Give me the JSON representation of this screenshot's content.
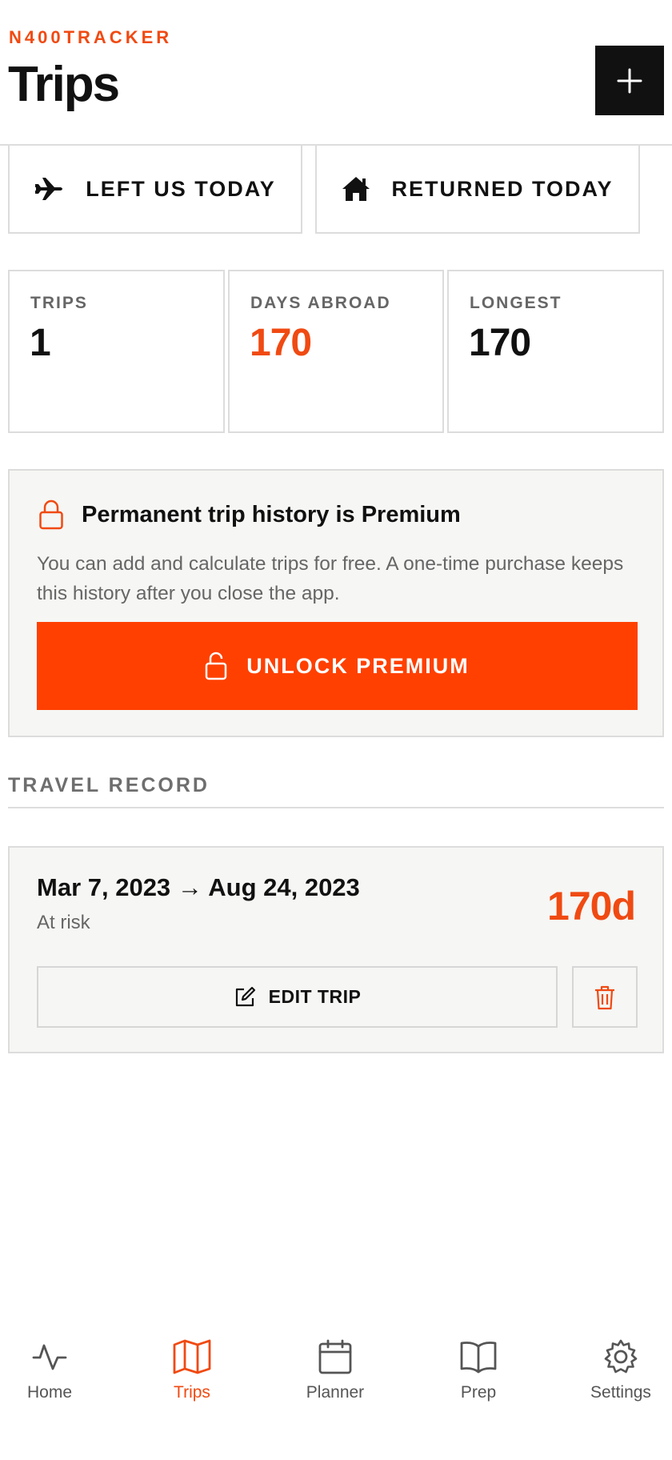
{
  "brand": "N400TRACKER",
  "header": {
    "title": "Trips",
    "add_icon": "plus-icon"
  },
  "quick_actions": {
    "left": {
      "label": "LEFT US TODAY",
      "icon": "airplane-icon"
    },
    "returned": {
      "label": "RETURNED TODAY",
      "icon": "house-icon"
    }
  },
  "stats": [
    {
      "label": "TRIPS",
      "value": "1"
    },
    {
      "label": "DAYS ABROAD",
      "value": "170"
    },
    {
      "label": "LONGEST",
      "value": "170"
    }
  ],
  "premium": {
    "title": "Permanent trip history is Premium",
    "body": "You can add and calculate trips for free. A one-time purchase keeps this history after you close the app.",
    "button_label": "UNLOCK PREMIUM"
  },
  "travel_record": {
    "title": "TRAVEL RECORD",
    "trips": [
      {
        "dates": "Mar 7, 2023 → Aug 24, 2023",
        "status": "At risk",
        "days": "170d",
        "edit_label": "EDIT TRIP"
      }
    ]
  },
  "nav": {
    "items": [
      {
        "label": "Home",
        "icon": "activity-icon"
      },
      {
        "label": "Trips",
        "icon": "map-icon",
        "active": true
      },
      {
        "label": "Planner",
        "icon": "calendar-icon"
      },
      {
        "label": "Prep",
        "icon": "book-icon"
      },
      {
        "label": "Settings",
        "icon": "gear-icon"
      }
    ]
  },
  "colors": {
    "accent": "#f04a12",
    "button": "#ff4000",
    "dark": "#111111",
    "muted": "#666666",
    "card_bg": "#f6f6f4",
    "border": "#dcdcdc"
  }
}
